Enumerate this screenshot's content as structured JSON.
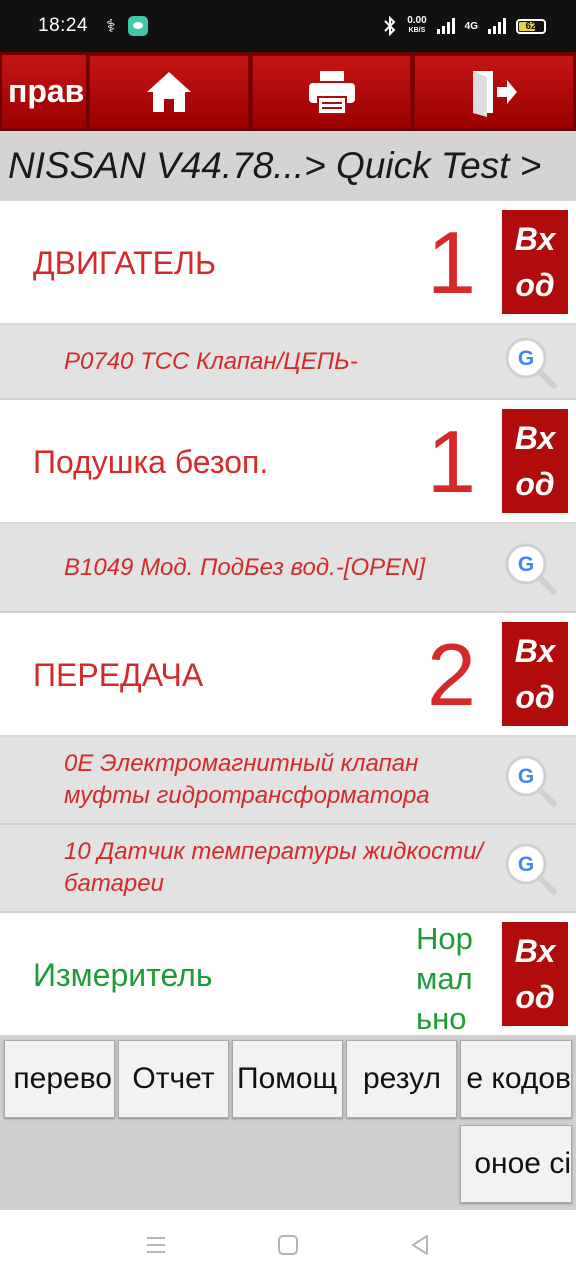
{
  "status_bar": {
    "time": "18:24",
    "net_speed_value": "0.00",
    "net_speed_unit": "KB/S",
    "network_type": "4G",
    "battery": "62",
    "icons": [
      "usb-icon",
      "chat-app-icon",
      "bluetooth-icon",
      "signal-icon",
      "battery-icon"
    ]
  },
  "toolbar": {
    "back_label": "прав",
    "icons": [
      "home-icon",
      "print-icon",
      "exit-icon"
    ]
  },
  "breadcrumb": "NISSAN V44.78...> Quick Test >",
  "systems": [
    {
      "name": "ДВИГАТЕЛЬ",
      "count": "1",
      "enter_line1": "Вх",
      "enter_line2": "од",
      "dtcs": [
        "P0740 TCC Клапан/ЦЕПЬ-"
      ]
    },
    {
      "name": "Подушка безоп.",
      "count": "1",
      "enter_line1": "Вх",
      "enter_line2": "од",
      "dtcs": [
        "B1049 Мод. ПодБез вод.-[OPEN]"
      ]
    },
    {
      "name": "ПЕРЕДАЧА",
      "count": "2",
      "enter_line1": "Вх",
      "enter_line2": "од",
      "dtcs": [
        "0E Электромагнитный клапан муфты гидротрансформатора",
        "10 Датчик температуры жидкости/батареи"
      ]
    },
    {
      "name": "Измеритель",
      "status": "Нор мал ьно",
      "enter_line1": "Вх",
      "enter_line2": "од"
    }
  ],
  "bottom_buttons": [
    "перево",
    "Отчет",
    "Помощ",
    "резул",
    "е кодов",
    "оное сі"
  ],
  "colors": {
    "toolbar_red": "#b00c0c",
    "fault_red": "#d42a2a",
    "normal_green": "#1f9c3a"
  }
}
